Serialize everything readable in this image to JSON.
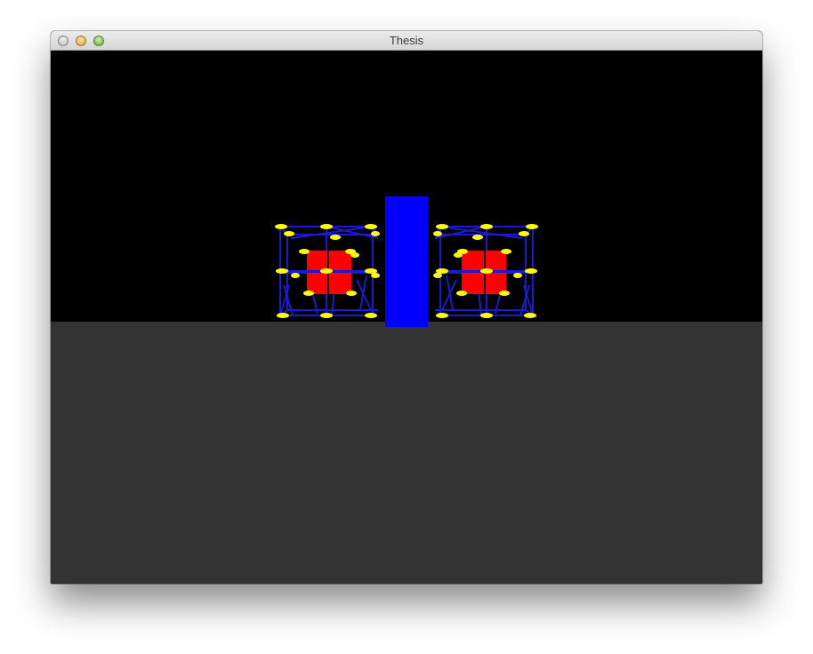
{
  "window": {
    "title": "Thesis"
  },
  "scene": {
    "colors": {
      "sky": "#000000",
      "ground": "#333333",
      "frame_edges": "#1a1ad0",
      "joints": "#ffff00",
      "cubes": "#ff0000",
      "pillar": "#0000ff"
    }
  }
}
